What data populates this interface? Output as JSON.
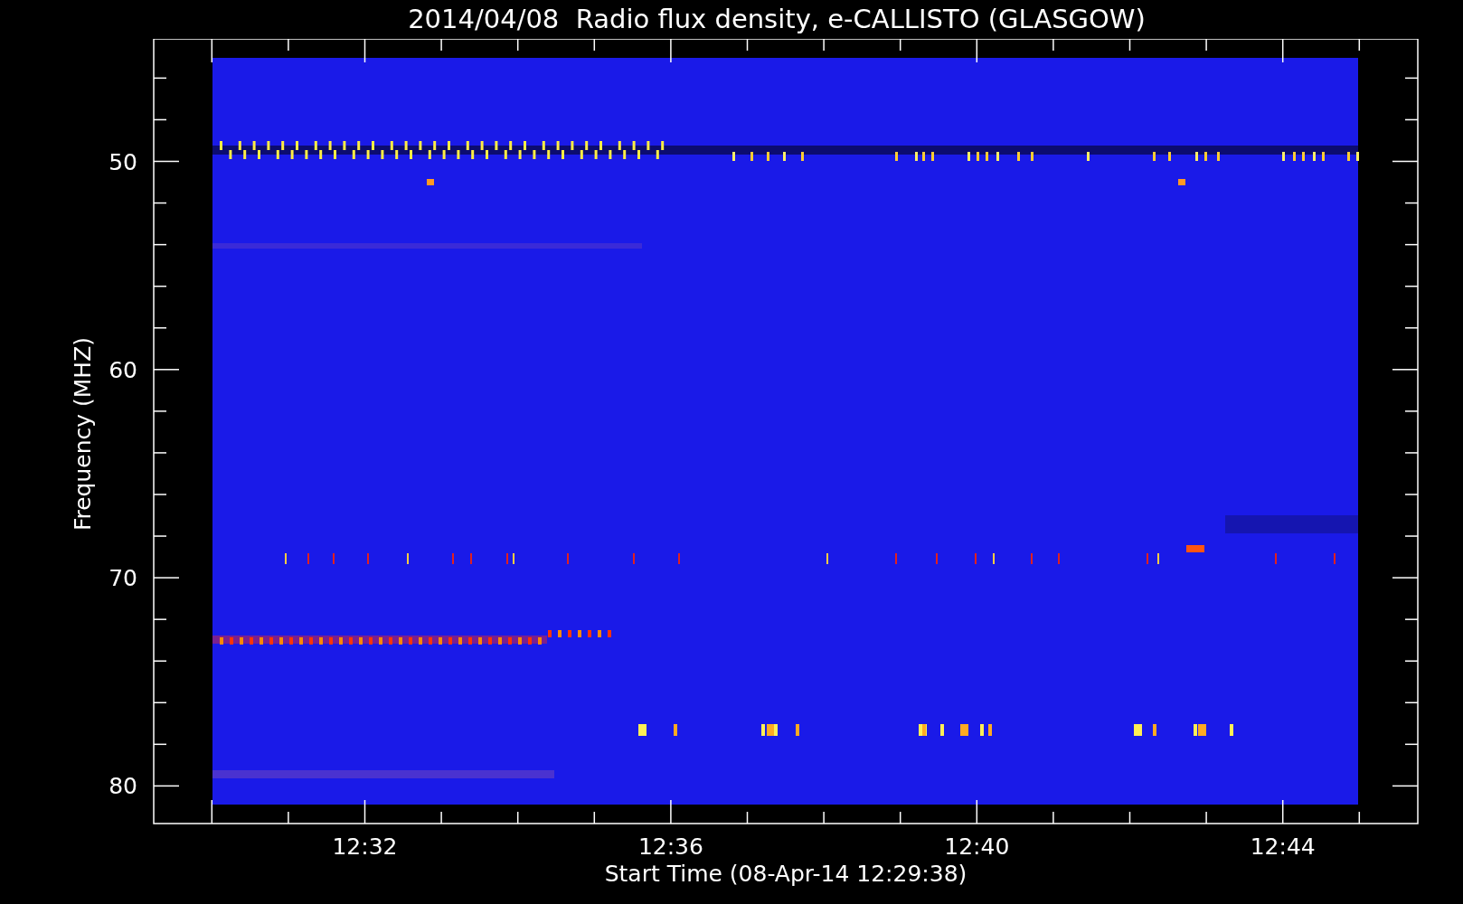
{
  "title": "2014/04/08  Radio flux density, e-CALLISTO (GLASGOW)",
  "y_axis": {
    "label": "Frequency (MHZ)",
    "ticks": [
      "50",
      "60",
      "70",
      "80"
    ]
  },
  "x_axis": {
    "label": "Start Time (08-Apr-14 12:29:38)",
    "ticks": [
      "12:32",
      "12:36",
      "12:40",
      "12:44"
    ]
  }
}
